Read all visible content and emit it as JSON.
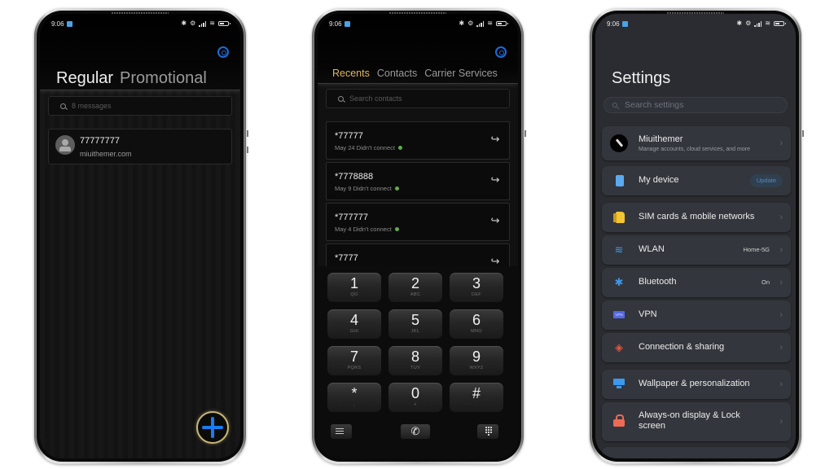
{
  "status_bar": {
    "time": "9:06",
    "icons": [
      "bluetooth-icon",
      "alarm-icon",
      "signal-icon",
      "wifi-icon",
      "battery-icon"
    ]
  },
  "messages_app": {
    "tabs": [
      {
        "label": "Regular",
        "active": true
      },
      {
        "label": "Promotional",
        "active": false
      }
    ],
    "settings_icon": "gear-icon",
    "search": {
      "placeholder": "8 messages"
    },
    "conversations": [
      {
        "title": "77777777",
        "subtitle": "miuithemer.com",
        "icon": "contact-avatar-icon"
      }
    ],
    "fab_icon": "plus-icon",
    "colors": {
      "fab_plus": "#1a7cf0",
      "fab_ring": "#c8b778",
      "gear": "#1e6ad6"
    }
  },
  "dialer_app": {
    "tabs": [
      {
        "label": "Recents",
        "active": true
      },
      {
        "label": "Contacts",
        "active": false
      },
      {
        "label": "Carrier Services",
        "active": false
      }
    ],
    "settings_icon": "gear-icon",
    "search": {
      "placeholder": "Search contacts"
    },
    "recents": [
      {
        "number": "*77777",
        "detail": "May 24 Didn't connect"
      },
      {
        "number": "*7778888",
        "detail": "May 9 Didn't connect"
      },
      {
        "number": "*777777",
        "detail": "May 4 Didn't connect"
      },
      {
        "number": "*7777",
        "detail": ""
      }
    ],
    "keypad": [
      {
        "num": "1",
        "letters": "QO"
      },
      {
        "num": "2",
        "letters": "ABC"
      },
      {
        "num": "3",
        "letters": "DEF"
      },
      {
        "num": "4",
        "letters": "GHI"
      },
      {
        "num": "5",
        "letters": "JKL"
      },
      {
        "num": "6",
        "letters": "MNO"
      },
      {
        "num": "7",
        "letters": "PQRS"
      },
      {
        "num": "8",
        "letters": "TUV"
      },
      {
        "num": "9",
        "letters": "WXYZ"
      },
      {
        "num": "*",
        "letters": ","
      },
      {
        "num": "0",
        "letters": "+"
      },
      {
        "num": "#",
        "letters": ""
      }
    ],
    "bottom_bar": {
      "menu_icon": "menu-icon",
      "call_icon": "phone-icon",
      "dialpad_icon": "dialpad-icon",
      "call_glyph": "✆"
    },
    "colors": {
      "active_tab": "#e0b85a",
      "sim_indicator": "#5fae4b"
    }
  },
  "settings_app": {
    "title": "Settings",
    "search": {
      "placeholder": "Search settings"
    },
    "items": [
      {
        "label": "Miuithemer",
        "subtitle": "Manage accounts, cloud services, and more",
        "value": "",
        "icon": "account-avatar-icon"
      },
      {
        "label": "My device",
        "subtitle": "",
        "value": "",
        "button": "Update",
        "icon": "device-icon"
      },
      {
        "label": "SIM cards & mobile networks",
        "subtitle": "",
        "value": "",
        "icon": "sim-card-icon"
      },
      {
        "label": "WLAN",
        "subtitle": "",
        "value": "Home-5G",
        "icon": "wifi-icon"
      },
      {
        "label": "Bluetooth",
        "subtitle": "",
        "value": "On",
        "icon": "bluetooth-icon"
      },
      {
        "label": "VPN",
        "subtitle": "",
        "value": "",
        "icon": "vpn-icon",
        "icon_text": "VPN"
      },
      {
        "label": "Connection & sharing",
        "subtitle": "",
        "value": "",
        "icon": "connection-sharing-icon"
      },
      {
        "label": "Wallpaper & personalization",
        "subtitle": "",
        "value": "",
        "icon": "wallpaper-icon"
      },
      {
        "label": "Always-on display & Lock screen",
        "subtitle": "",
        "value": "",
        "icon": "lock-icon"
      }
    ],
    "chevron": "›",
    "glyphs": {
      "wifi": "≋",
      "bluetooth": "✱",
      "share": "◈",
      "forward": "↪"
    }
  }
}
